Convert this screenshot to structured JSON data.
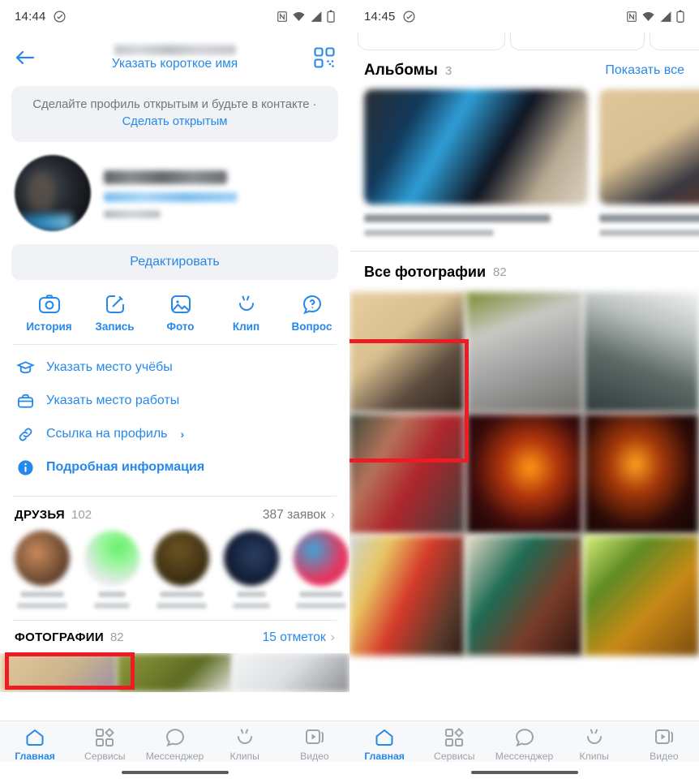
{
  "app": "VK mobile profile",
  "left": {
    "status": {
      "time": "14:44",
      "icons": [
        "clock-icon",
        "nfc-icon",
        "wifi-icon",
        "cellular-icon",
        "battery-icon"
      ]
    },
    "header": {
      "back": "back-arrow-icon",
      "name_hidden": "",
      "short_name_link": "Указать короткое имя",
      "qr": "qr-code-icon"
    },
    "banner": {
      "text": "Сделайте профиль открытым и будьте в контакте · ",
      "link": "Сделать открытым"
    },
    "edit_button": "Редактировать",
    "actions": [
      {
        "label": "История",
        "icon": "camera-icon"
      },
      {
        "label": "Запись",
        "icon": "pencil-square-icon"
      },
      {
        "label": "Фото",
        "icon": "photo-icon"
      },
      {
        "label": "Клип",
        "icon": "clip-icon"
      },
      {
        "label": "Вопрос",
        "icon": "question-bubble-icon"
      }
    ],
    "info_items": [
      {
        "label": "Указать место учёбы",
        "icon": "graduation-cap-icon"
      },
      {
        "label": "Указать место работы",
        "icon": "briefcase-icon"
      },
      {
        "label": "Ссылка на профиль",
        "icon": "link-icon",
        "chevron": "›"
      },
      {
        "label": "Подробная информация",
        "icon": "info-circle-icon"
      }
    ],
    "friends_section": {
      "title": "ДРУЗЬЯ",
      "count": "102",
      "action": "387 заявок",
      "chevron": "›"
    },
    "photos_section": {
      "title": "ФОТОГРАФИИ",
      "count": "82",
      "action": "15 отметок",
      "chevron": "›"
    },
    "highlight": {
      "color": "#ed1c24",
      "target": "photos-section-header"
    }
  },
  "right": {
    "status": {
      "time": "14:45",
      "icons": [
        "clock-icon",
        "nfc-icon",
        "wifi-icon",
        "cellular-icon",
        "battery-icon"
      ]
    },
    "albums_section": {
      "title": "Альбомы",
      "count": "3",
      "link": "Показать все"
    },
    "all_photos_section": {
      "title": "Все фотографии",
      "count": "82"
    },
    "highlight": {
      "color": "#ed1c24",
      "target": "photo-grid-cell-1"
    }
  },
  "bottom_nav": {
    "items": [
      {
        "label": "Главная",
        "icon": "home-icon",
        "active": true
      },
      {
        "label": "Сервисы",
        "icon": "services-grid-icon",
        "active": false
      },
      {
        "label": "Мессенджер",
        "icon": "chat-bubble-icon",
        "active": false
      },
      {
        "label": "Клипы",
        "icon": "clips-icon",
        "active": false
      },
      {
        "label": "Видео",
        "icon": "video-icon",
        "active": false
      }
    ]
  },
  "colors": {
    "accent": "#2688eb",
    "highlight": "#ed1c24",
    "muted": "#9aa0a6",
    "panel": "#f0f2f5"
  }
}
